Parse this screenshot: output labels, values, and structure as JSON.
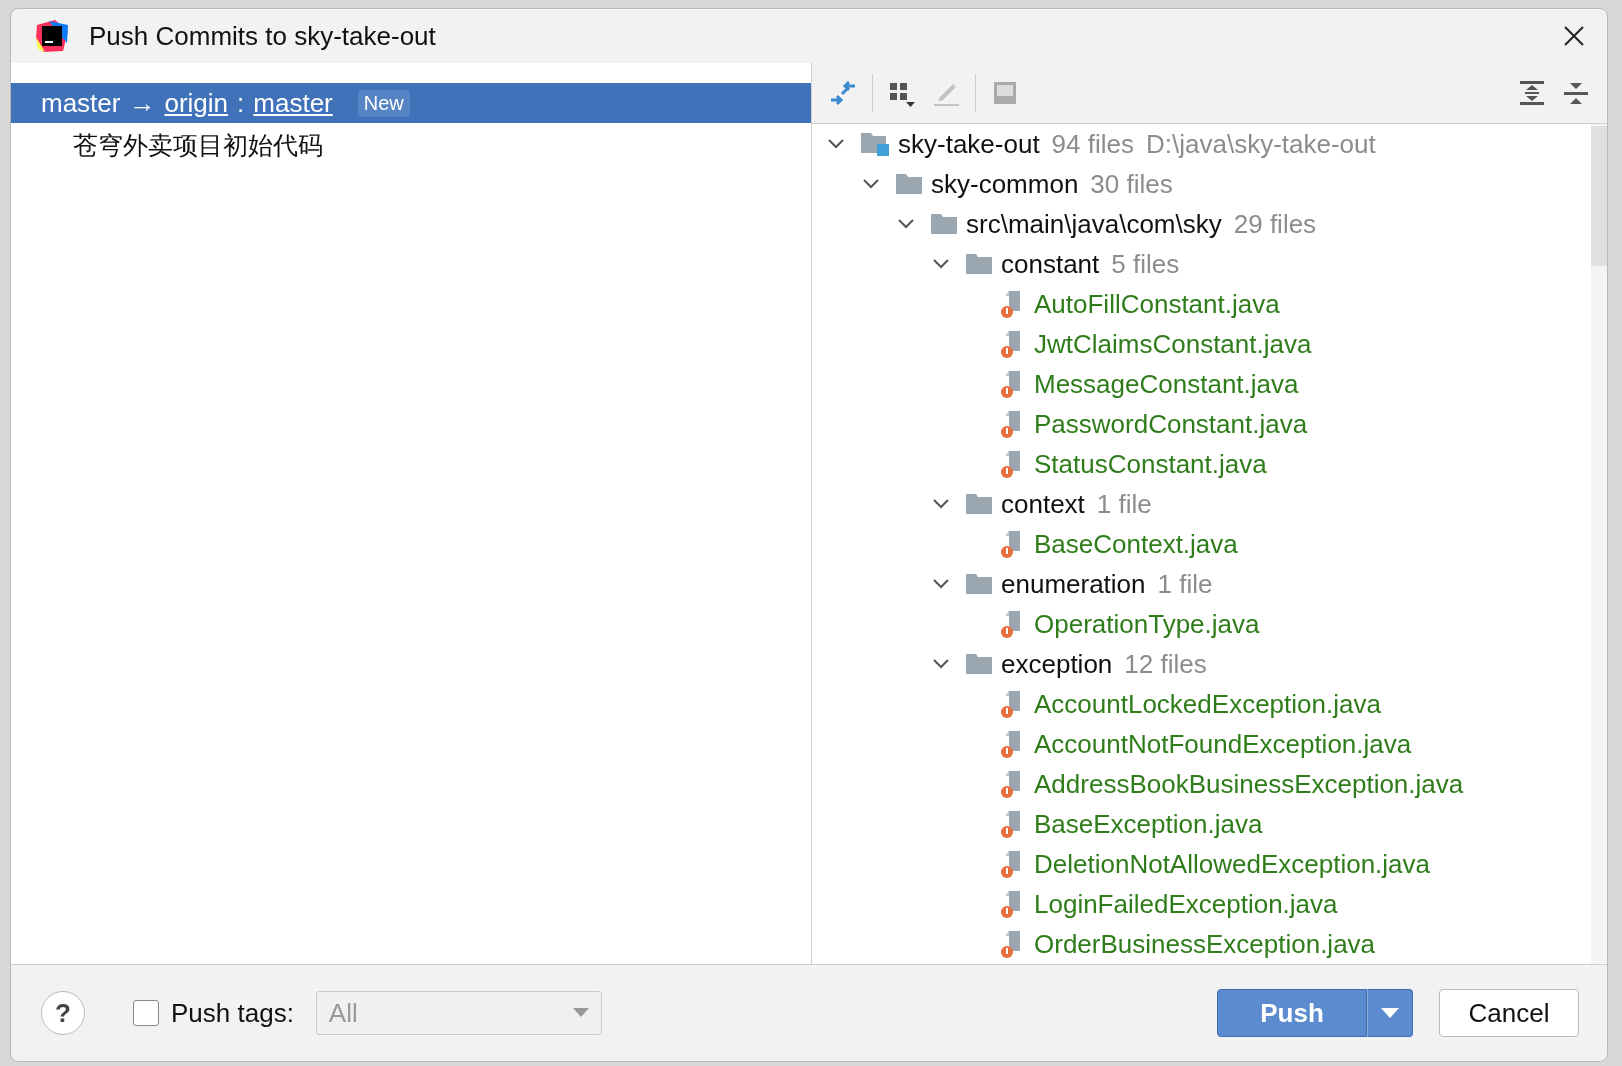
{
  "window": {
    "title": "Push Commits to sky-take-out"
  },
  "push_target": {
    "source": "master",
    "arrow": "→",
    "remote": "origin",
    "separator": ":",
    "branch": "master",
    "badge": "New",
    "selected": true
  },
  "commits": [
    {
      "message": "苍穹外卖项目初始代码"
    }
  ],
  "tree": [
    {
      "kind": "module",
      "name": "sky-take-out",
      "count": "94 files",
      "path": "D:\\java\\sky-take-out",
      "expanded": true,
      "children": [
        {
          "kind": "folder",
          "name": "sky-common",
          "count": "30 files",
          "expanded": true,
          "children": [
            {
              "kind": "folder",
              "name": "src\\main\\java\\com\\sky",
              "count": "29 files",
              "expanded": true,
              "children": [
                {
                  "kind": "folder",
                  "name": "constant",
                  "count": "5 files",
                  "expanded": true,
                  "children": [
                    {
                      "kind": "file",
                      "name": "AutoFillConstant.java"
                    },
                    {
                      "kind": "file",
                      "name": "JwtClaimsConstant.java"
                    },
                    {
                      "kind": "file",
                      "name": "MessageConstant.java"
                    },
                    {
                      "kind": "file",
                      "name": "PasswordConstant.java"
                    },
                    {
                      "kind": "file",
                      "name": "StatusConstant.java"
                    }
                  ]
                },
                {
                  "kind": "folder",
                  "name": "context",
                  "count": "1 file",
                  "expanded": true,
                  "children": [
                    {
                      "kind": "file",
                      "name": "BaseContext.java"
                    }
                  ]
                },
                {
                  "kind": "folder",
                  "name": "enumeration",
                  "count": "1 file",
                  "expanded": true,
                  "children": [
                    {
                      "kind": "file",
                      "name": "OperationType.java"
                    }
                  ]
                },
                {
                  "kind": "folder",
                  "name": "exception",
                  "count": "12 files",
                  "expanded": true,
                  "children": [
                    {
                      "kind": "file",
                      "name": "AccountLockedException.java"
                    },
                    {
                      "kind": "file",
                      "name": "AccountNotFoundException.java"
                    },
                    {
                      "kind": "file",
                      "name": "AddressBookBusinessException.java"
                    },
                    {
                      "kind": "file",
                      "name": "BaseException.java"
                    },
                    {
                      "kind": "file",
                      "name": "DeletionNotAllowedException.java"
                    },
                    {
                      "kind": "file",
                      "name": "LoginFailedException.java"
                    },
                    {
                      "kind": "file",
                      "name": "OrderBusinessException.java"
                    }
                  ]
                }
              ]
            }
          ]
        }
      ]
    }
  ],
  "footer": {
    "help": "?",
    "push_tags": {
      "label": "Push tags:",
      "checked": false
    },
    "tags_dropdown": {
      "value": "All",
      "disabled": true
    },
    "buttons": [
      {
        "label": "Push",
        "kind": "split-primary"
      },
      {
        "label": "Cancel",
        "kind": "plain"
      }
    ]
  }
}
